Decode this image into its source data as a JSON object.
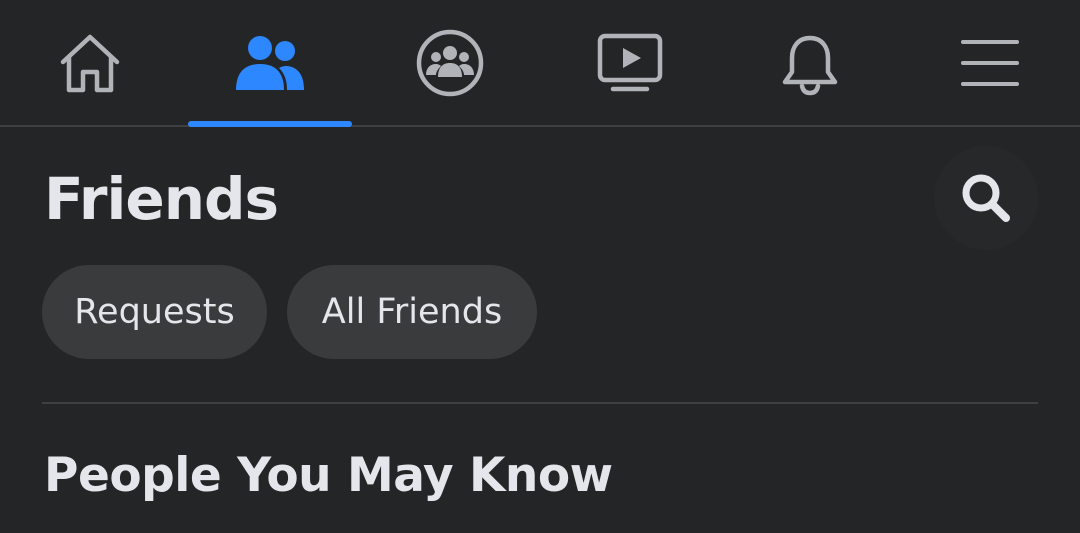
{
  "nav": {
    "tabs": [
      {
        "id": "home",
        "icon": "home-icon",
        "active": false
      },
      {
        "id": "friends",
        "icon": "friends-icon",
        "active": true
      },
      {
        "id": "groups",
        "icon": "groups-icon",
        "active": false
      },
      {
        "id": "watch",
        "icon": "video-icon",
        "active": false
      },
      {
        "id": "notifications",
        "icon": "bell-icon",
        "active": false
      },
      {
        "id": "menu",
        "icon": "hamburger-menu-icon",
        "active": false
      }
    ],
    "active_color": "#2d88ff",
    "inactive_color": "#b0b3b8"
  },
  "header": {
    "title": "Friends",
    "search_icon": "search-icon"
  },
  "chips": {
    "requests": "Requests",
    "all_friends": "All Friends"
  },
  "section": {
    "title": "People You May Know"
  },
  "colors": {
    "background": "#242526",
    "text": "#e4e6eb",
    "chip_background": "#3a3b3c",
    "divider": "#3e4042"
  }
}
